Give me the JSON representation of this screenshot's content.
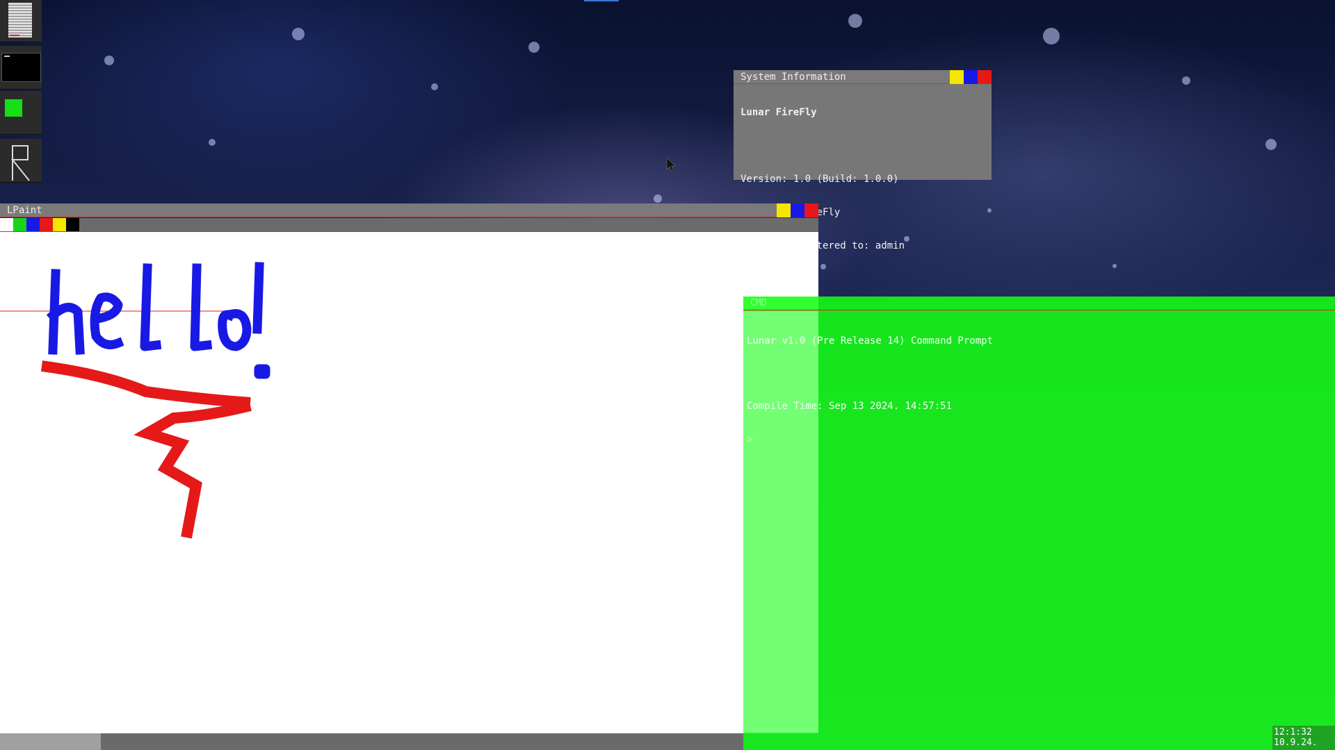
{
  "desktop": {
    "dock": {
      "items": [
        {
          "name": "documents-app",
          "icon": "document-icon"
        },
        {
          "name": "terminal-app",
          "icon": "terminal-icon"
        },
        {
          "name": "green-app",
          "icon": "green-square-icon"
        },
        {
          "name": "r-app",
          "icon": "r-logo-icon"
        }
      ]
    }
  },
  "sysinfo": {
    "title": "System Information",
    "product": "Lunar FireFly",
    "version": "Version: 1.0 (Build: 1.0.0)",
    "codename": "Codename: FireFly",
    "registered": "Product registered to: admin"
  },
  "lpaint": {
    "title": "LPaint",
    "palette": [
      "#ffffff",
      "#19d419",
      "#1919e6",
      "#e61919",
      "#f5e600",
      "#000000"
    ],
    "drawing_text": "hello!"
  },
  "cmd": {
    "title": "CMD",
    "line1": "Lunar v1.0 (Pre Release 14) Command Prompt",
    "line2": "Compile Time: Sep 13 2024. 14:57:51",
    "prompt": ">"
  },
  "window_buttons": {
    "colors": [
      "#f5e600",
      "#1919e6",
      "#e61919"
    ]
  },
  "clock": {
    "time": "12:1:32",
    "date": "10.9.24."
  }
}
